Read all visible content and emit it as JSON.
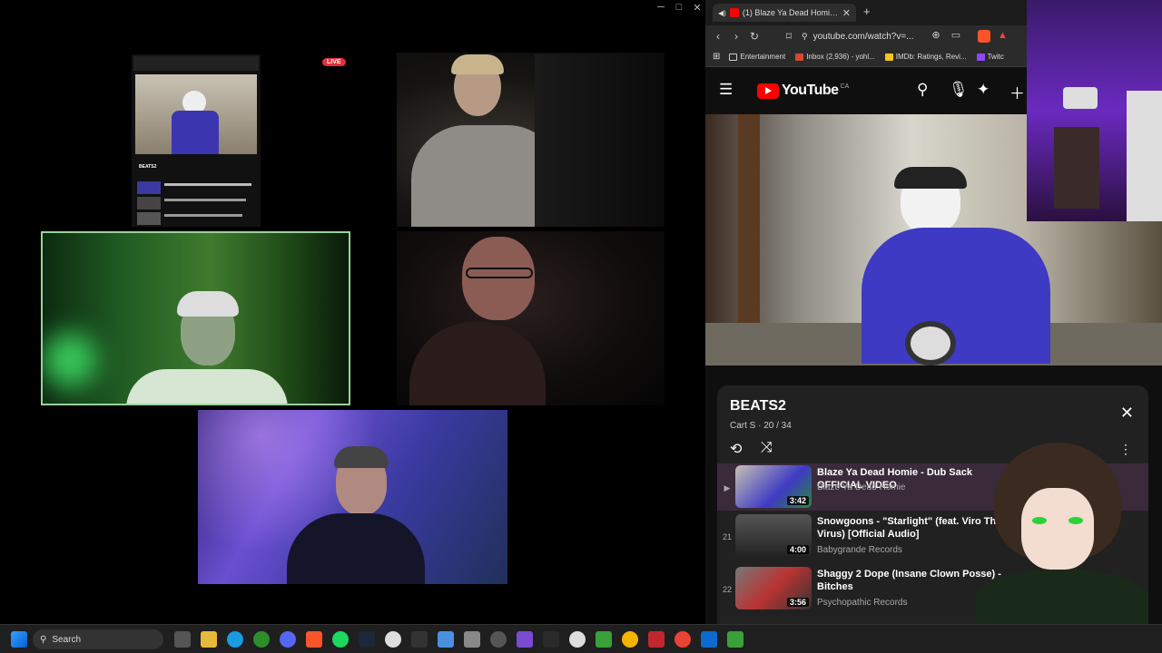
{
  "call": {
    "live_badge": "LIVE",
    "window_controls": [
      "─",
      "□",
      "✕"
    ],
    "mini_playlist": {
      "title": "BEATS2"
    }
  },
  "browser": {
    "tab_title": "(1) Blaze Ya Dead Homie - Du",
    "new_tab": "+",
    "url": "youtube.com/watch?v=...",
    "bookmarks": [
      {
        "label": "Entertainment",
        "color": "#e6c34a"
      },
      {
        "label": "Inbox (2,936) - yohl...",
        "color": "#d44638"
      },
      {
        "label": "IMDb: Ratings, Revi...",
        "color": "#f5c518"
      },
      {
        "label": "Twitc",
        "color": "#9146ff"
      }
    ]
  },
  "youtube": {
    "brand": "YouTube",
    "country": "CA",
    "playlist": {
      "title": "BEATS2",
      "subtitle": "Cart S · 20 / 34",
      "items": [
        {
          "index": "▶",
          "title": "Blaze Ya Dead Homie - Dub Sack OFFICIAL VIDEO",
          "channel": "Blaze Ya Dead Homie",
          "duration": "3:42",
          "active": true
        },
        {
          "index": "21",
          "title": "Snowgoons - \"Starlight\" (feat. Viro The Virus) [Official Audio]",
          "channel": "Babygrande Records",
          "duration": "4:00",
          "active": false
        },
        {
          "index": "22",
          "title": "Shaggy 2 Dope (Insane Clown Posse) - Bitches",
          "channel": "Psychopathic Records",
          "duration": "3:56",
          "active": false
        }
      ]
    }
  },
  "taskbar": {
    "search_label": "Search"
  }
}
